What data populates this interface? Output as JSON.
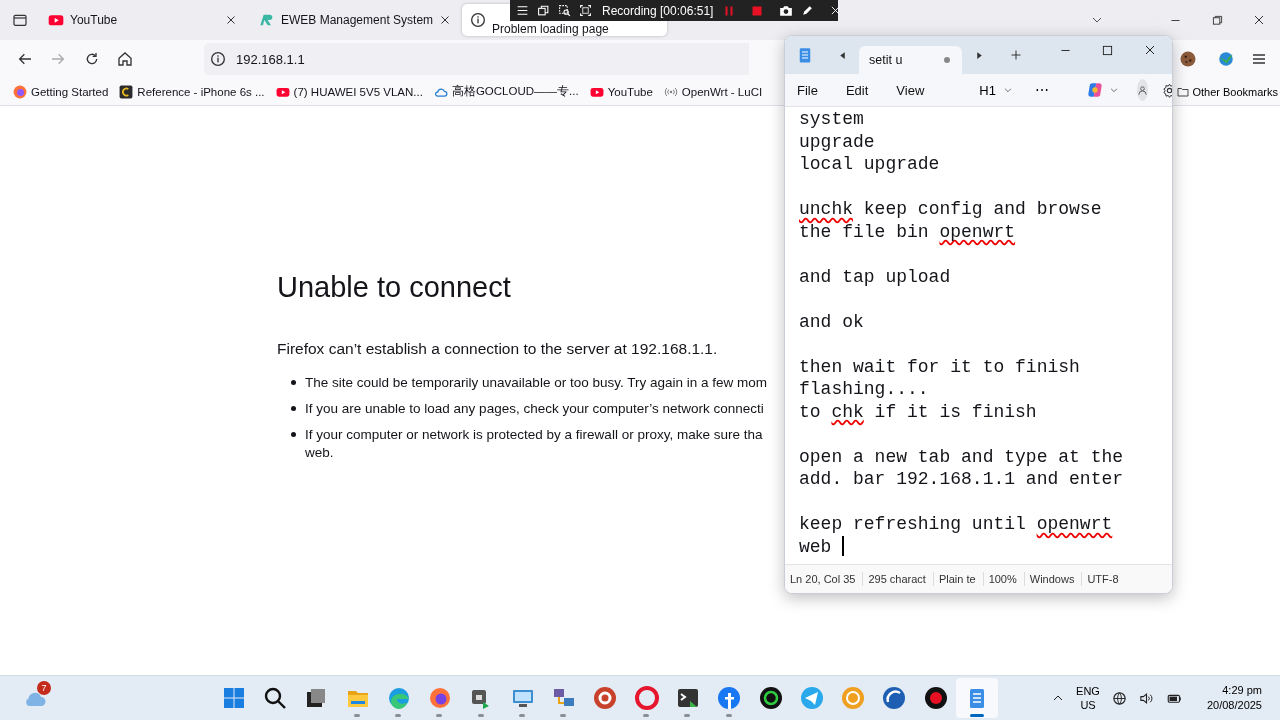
{
  "browser": {
    "tabs": [
      {
        "title": "YouTube",
        "kind": "video",
        "selected": false
      },
      {
        "title": "EWEB Management System",
        "kind": "logo",
        "selected": false
      },
      {
        "title": "Problem loading page",
        "kind": "info",
        "selected": true
      }
    ],
    "address": "192.168.1.1",
    "bookmarks": [
      {
        "label": "Getting Started",
        "kind": "browser"
      },
      {
        "label": "Reference - iPhone 6s ...",
        "kind": "badge"
      },
      {
        "label": "(7) HUAWEI 5V5 VLAN...",
        "kind": "video"
      },
      {
        "label": "高格GOCLOUD——专...",
        "kind": "cloud"
      },
      {
        "label": "YouTube",
        "kind": "video"
      },
      {
        "label": "OpenWrt - LuCI",
        "kind": "signal"
      }
    ],
    "other_bookmarks": "Other Bookmarks",
    "error": {
      "title": "Unable to connect",
      "message": "Firefox can’t establish a connection to the server at 192.168.1.1.",
      "bullets": [
        {
          "lines": [
            "The site could be temporarily unavailable or too busy. Try again in a few mom"
          ]
        },
        {
          "lines": [
            "If you are unable to load any pages, check your computer’s network connecti"
          ]
        },
        {
          "lines": [
            "If your computer or network is protected by a firewall or proxy, make sure tha",
            "web."
          ]
        }
      ]
    }
  },
  "recorder": {
    "label": "Recording [00:06:51]"
  },
  "notepad": {
    "tab": {
      "title": "setit u",
      "modified": true
    },
    "menu": [
      "File",
      "Edit",
      "View"
    ],
    "heading": "H1",
    "more": "⋯",
    "paragraphs": [
      [
        [
          {
            "text": "system",
            "misspelled": false
          }
        ],
        [
          {
            "text": "upgrade",
            "misspelled": false
          }
        ],
        [
          {
            "text": "local upgrade",
            "misspelled": false
          }
        ]
      ],
      [
        [
          {
            "text": "unchk",
            "misspelled": true
          },
          {
            "text": " keep config and browse",
            "misspelled": false
          }
        ],
        [
          {
            "text": "the file bin ",
            "misspelled": false
          },
          {
            "text": "openwrt",
            "misspelled": true
          }
        ]
      ],
      [
        [
          {
            "text": "and tap upload",
            "misspelled": false
          }
        ]
      ],
      [
        [
          {
            "text": "and ok",
            "misspelled": false
          }
        ]
      ],
      [
        [
          {
            "text": "then wait for it to finish",
            "misspelled": false
          }
        ],
        [
          {
            "text": "flashing....",
            "misspelled": false
          }
        ],
        [
          {
            "text": "to ",
            "misspelled": false
          },
          {
            "text": "chk",
            "misspelled": true
          },
          {
            "text": " if it is finish",
            "misspelled": false
          }
        ]
      ],
      [
        [
          {
            "text": "open a new tab and type at the",
            "misspelled": false
          }
        ],
        [
          {
            "text": "add. bar 192.168.1.1 and enter",
            "misspelled": false
          }
        ]
      ],
      [
        [
          {
            "text": "keep refreshing until ",
            "misspelled": false
          },
          {
            "text": "openwrt",
            "misspelled": true
          }
        ],
        [
          {
            "text": "web ",
            "misspelled": false
          }
        ]
      ]
    ],
    "status": [
      "Ln 20, Col 35",
      "295 charact",
      "Plain te",
      "100%",
      "Windows",
      "UTF-8"
    ]
  },
  "taskbar": {
    "notifications": "7",
    "apps": [
      {
        "running": false,
        "selected": false
      },
      {
        "running": false,
        "selected": false
      },
      {
        "running": false,
        "selected": false
      },
      {
        "running": true,
        "selected": false
      },
      {
        "running": true,
        "selected": false
      },
      {
        "running": true,
        "selected": false
      },
      {
        "running": true,
        "selected": false
      },
      {
        "running": true,
        "selected": false
      },
      {
        "running": true,
        "selected": false
      },
      {
        "running": false,
        "selected": false
      },
      {
        "running": true,
        "selected": false
      },
      {
        "running": true,
        "selected": false
      },
      {
        "running": true,
        "selected": false
      },
      {
        "running": false,
        "selected": false
      },
      {
        "running": false,
        "selected": false
      },
      {
        "running": false,
        "selected": false
      },
      {
        "running": false,
        "selected": false
      },
      {
        "running": false,
        "selected": false
      },
      {
        "running": true,
        "selected": true
      }
    ],
    "language": "ENG",
    "region": "US",
    "time": "4:29 pm",
    "date": "20/08/2025"
  }
}
